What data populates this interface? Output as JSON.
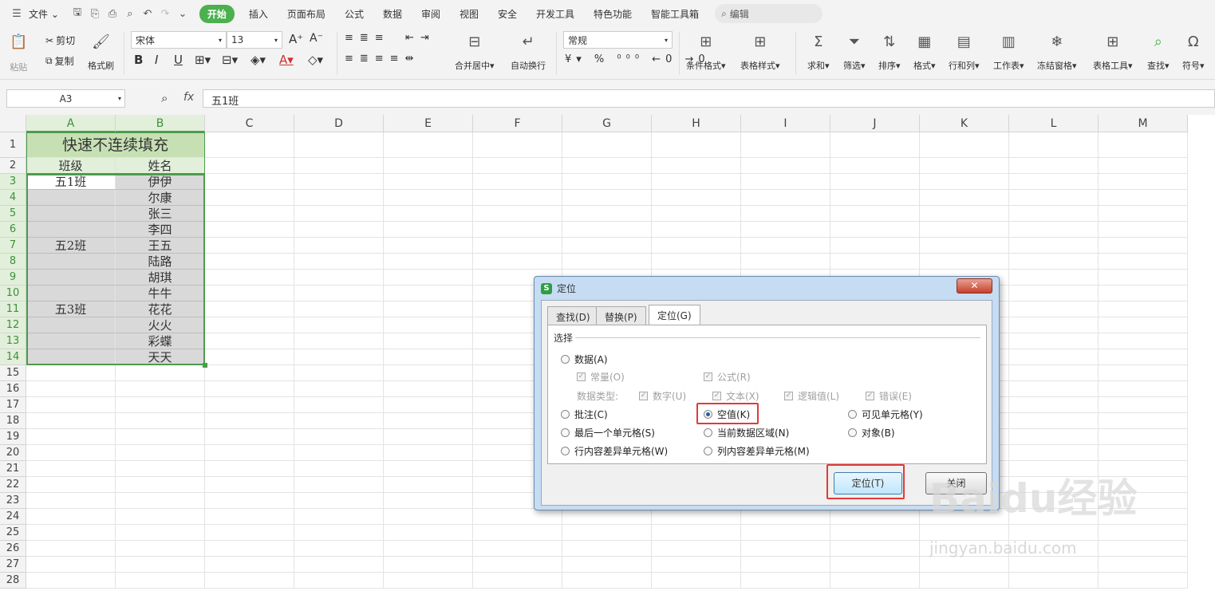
{
  "menubar": {
    "file": "文件",
    "tabs": [
      "开始",
      "插入",
      "页面布局",
      "公式",
      "数据",
      "审阅",
      "视图",
      "安全",
      "开发工具",
      "特色功能",
      "智能工具箱"
    ],
    "search": "编辑"
  },
  "ribbon": {
    "paste": "粘贴",
    "cut": "剪切",
    "copy": "复制",
    "format_painter": "格式刷",
    "font_name": "宋体",
    "font_size": "13",
    "merge_center": "合并居中",
    "wrap": "自动换行",
    "number_format": "常规",
    "cond_format": "条件格式",
    "table_style": "表格样式",
    "sum": "求和",
    "filter": "筛选",
    "sort": "排序",
    "format": "格式",
    "rowcol": "行和列",
    "sheet": "工作表",
    "freeze": "冻结窗格",
    "table_tools": "表格工具",
    "find": "查找",
    "symbol": "符号"
  },
  "formula_bar": {
    "name_box": "A3",
    "fx": "fx",
    "content": "五1班"
  },
  "sheet": {
    "columns": [
      "A",
      "B",
      "C",
      "D",
      "E",
      "F",
      "G",
      "H",
      "I",
      "J",
      "K",
      "L",
      "M"
    ],
    "rows": [
      "1",
      "2",
      "3",
      "4",
      "5",
      "6",
      "7",
      "8",
      "9",
      "10",
      "11",
      "12",
      "13",
      "14",
      "15",
      "16",
      "17",
      "18",
      "19",
      "20",
      "21",
      "22",
      "23",
      "24",
      "25",
      "26",
      "27",
      "28"
    ],
    "title": "快速不连续填充",
    "header_a": "班级",
    "header_b": "姓名",
    "col_a": [
      "五1班",
      "",
      "",
      "",
      "五2班",
      "",
      "",
      "",
      "五3班",
      "",
      "",
      ""
    ],
    "col_b": [
      "伊伊",
      "尔康",
      "张三",
      "李四",
      "王五",
      "陆路",
      "胡琪",
      "牛牛",
      "花花",
      "火火",
      "彩蝶",
      "天天"
    ]
  },
  "dialog": {
    "title": "定位",
    "close": "✕",
    "tabs": [
      "查找(D)",
      "替换(P)",
      "定位(G)"
    ],
    "section": "选择",
    "opt_data": "数据(A)",
    "opt_constant": "常量(O)",
    "opt_formula": "公式(R)",
    "data_type_label": "数据类型:",
    "opt_number": "数字(U)",
    "opt_text": "文本(X)",
    "opt_logic": "逻辑值(L)",
    "opt_error": "错误(E)",
    "opt_comment": "批注(C)",
    "opt_blank": "空值(K)",
    "opt_visible": "可见单元格(Y)",
    "opt_last": "最后一个单元格(S)",
    "opt_region": "当前数据区域(N)",
    "opt_object": "对象(B)",
    "opt_rowdiff": "行内容差异单元格(W)",
    "opt_coldiff": "列内容差异单元格(M)",
    "btn_locate": "定位(T)",
    "btn_close": "关闭"
  },
  "watermark": {
    "logo": "Baidu经验",
    "url": "jingyan.baidu.com"
  }
}
